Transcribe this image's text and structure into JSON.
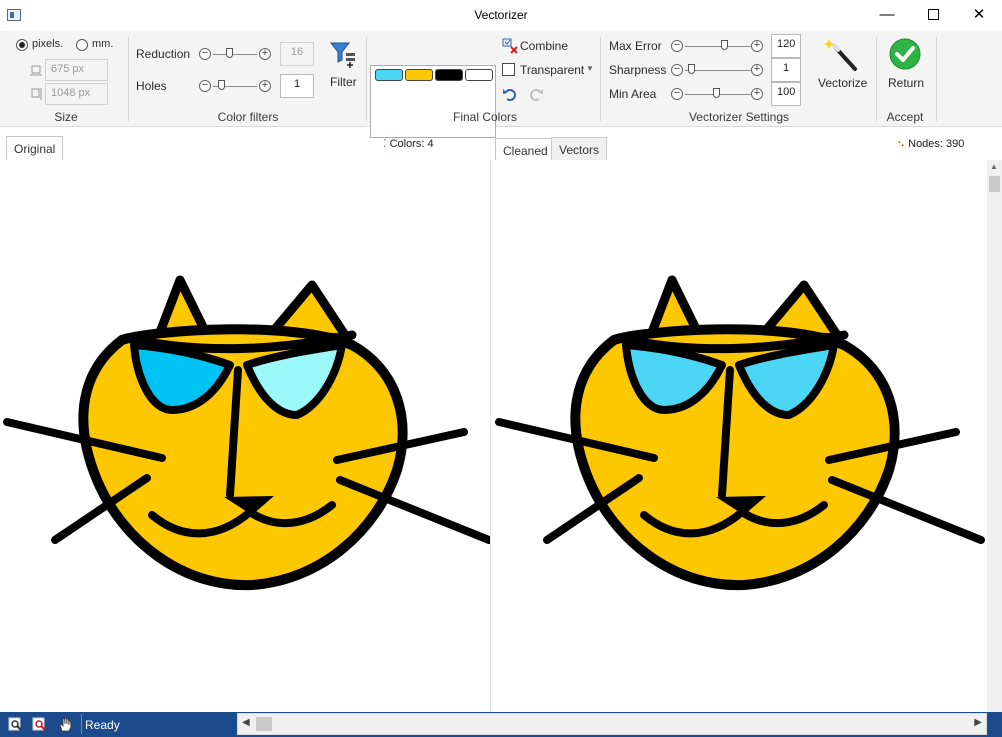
{
  "window": {
    "title": "Vectorizer",
    "minimize": "—",
    "close": "✕"
  },
  "size_group": {
    "label": "Size",
    "unit_pixels": "pixels.",
    "unit_mm": "mm.",
    "width_value": "675 px",
    "height_value": "1048 px",
    "selected_unit": "pixels."
  },
  "color_filters": {
    "label": "Color filters",
    "reduction_label": "Reduction",
    "reduction_value": "16",
    "holes_label": "Holes",
    "holes_value": "1",
    "filter_label": "Filter"
  },
  "final_colors": {
    "label": "Final Colors",
    "swatches": [
      "#4bd6f5",
      "#fec800",
      "#000000",
      "#ffffff"
    ],
    "combine_label": "Combine",
    "transparent_label": "Transparent",
    "transparent_checked": false
  },
  "vectorizer_settings": {
    "label": "Vectorizer Settings",
    "max_error_label": "Max Error",
    "max_error_value": "120",
    "sharpness_label": "Sharpness",
    "sharpness_value": "1",
    "min_area_label": "Min Area",
    "min_area_value": "100",
    "vectorize_label": "Vectorize"
  },
  "accept_group": {
    "label": "Accept",
    "return_label": "Return"
  },
  "tabs": {
    "original": "Original",
    "cleaned": "Cleaned",
    "vectors": "Vectors"
  },
  "info": {
    "colors": "Colors: 4",
    "nodes": "Nodes: 390"
  },
  "status": {
    "text": "Ready"
  },
  "cat_colors": {
    "face": "#fec800",
    "outline": "#000000",
    "eye_left_original": "#00c3f5",
    "eye_right_original": "#9cf9f9",
    "eye_cleaned": "#4bd6f5"
  }
}
